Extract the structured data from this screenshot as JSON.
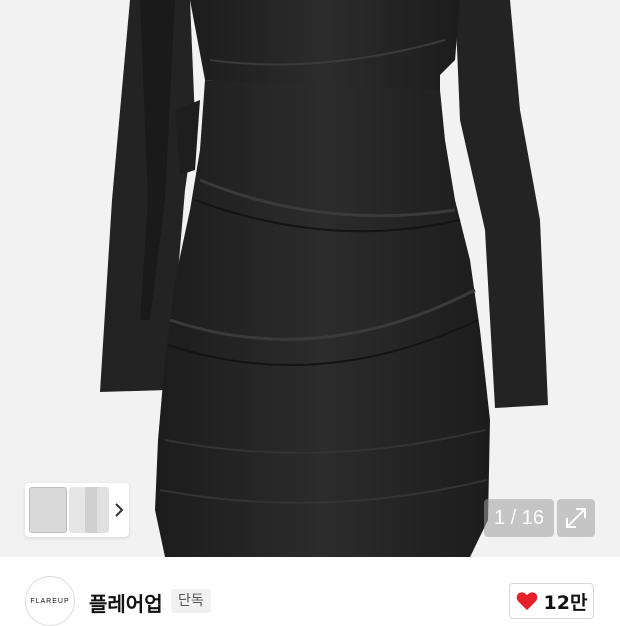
{
  "gallery": {
    "counter": "1 / 16",
    "expand_icon": "expand-icon",
    "thumb_next_icon": "chevron-right-icon",
    "background": "#f2f2f2",
    "dress_color": "#262626"
  },
  "brand": {
    "logo_text": "FLAREUP",
    "name": "플레어업",
    "badge": "단독"
  },
  "like": {
    "icon": "heart-icon",
    "icon_color": "#e8202a",
    "count": "12만"
  }
}
